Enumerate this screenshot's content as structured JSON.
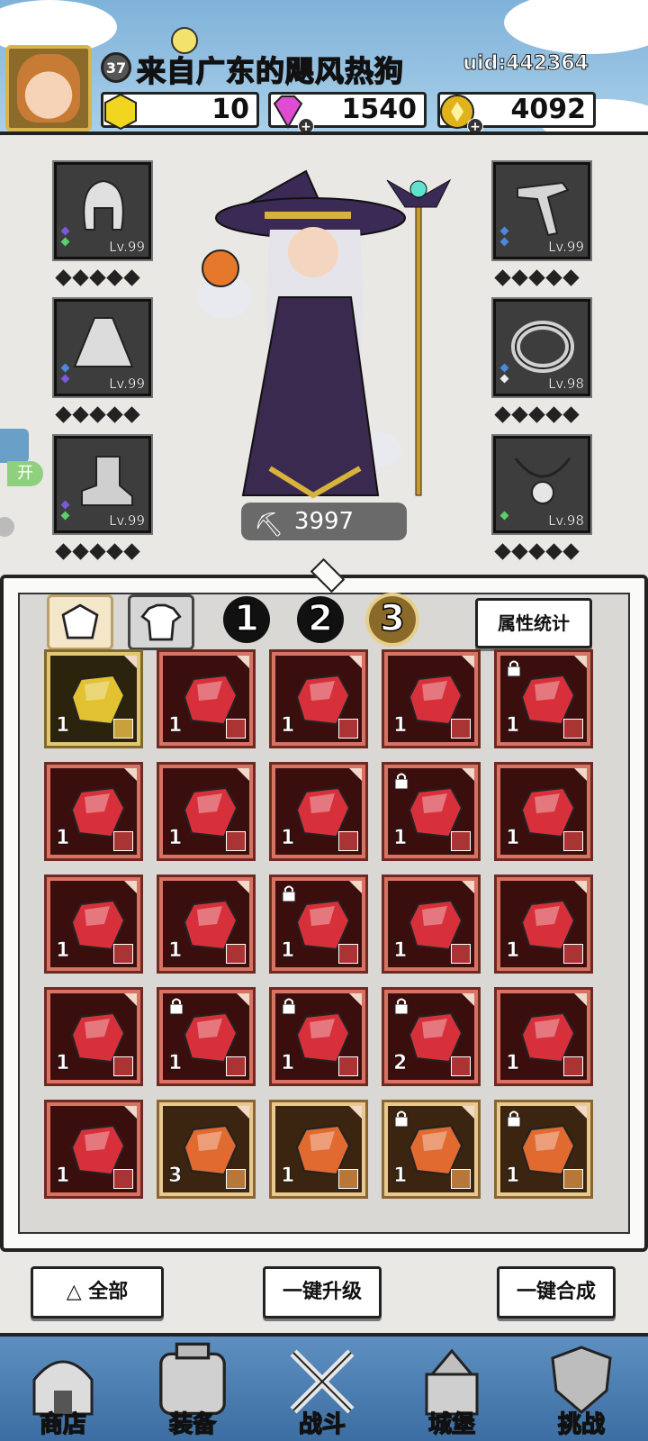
{
  "player": {
    "level": "37",
    "name": "来自广东的飓风热狗",
    "uid": "uid:442364"
  },
  "resources": [
    {
      "name": "gold-gem",
      "value": "10",
      "has_plus": false,
      "color": "#f2d51f"
    },
    {
      "name": "diamond",
      "value": "1540",
      "has_plus": true,
      "color": "#e04bd3"
    },
    {
      "name": "coin",
      "value": "4092",
      "has_plus": true,
      "color": "#e0b31c"
    }
  ],
  "equipment": {
    "left": [
      {
        "slot": "helmet",
        "level": "Lv.99"
      },
      {
        "slot": "cape",
        "level": "Lv.99"
      },
      {
        "slot": "boots",
        "level": "Lv.99"
      }
    ],
    "right": [
      {
        "slot": "weapon",
        "level": "Lv.99"
      },
      {
        "slot": "ring",
        "level": "Lv.98"
      },
      {
        "slot": "necklace",
        "level": "Lv.98"
      }
    ]
  },
  "power": "3997",
  "side_button": "开",
  "tabs": {
    "pages": [
      "1",
      "2",
      "3"
    ],
    "active_page": "3",
    "stats_button": "属性统计"
  },
  "inventory": [
    {
      "type": "gold",
      "count": "1",
      "locked": false,
      "icon": "ring-type-icon"
    },
    {
      "type": "red",
      "count": "1",
      "locked": false,
      "icon": "cape-type-icon"
    },
    {
      "type": "red",
      "count": "1",
      "locked": false,
      "icon": "cape-type-icon"
    },
    {
      "type": "red",
      "count": "1",
      "locked": false,
      "icon": "cape-type-icon"
    },
    {
      "type": "red",
      "count": "1",
      "locked": true,
      "icon": "boots-type-icon"
    },
    {
      "type": "red",
      "count": "1",
      "locked": false,
      "icon": "boots-type-icon"
    },
    {
      "type": "red",
      "count": "1",
      "locked": false,
      "icon": "boots-type-icon"
    },
    {
      "type": "red",
      "count": "1",
      "locked": false,
      "icon": "boots-type-icon"
    },
    {
      "type": "red",
      "count": "1",
      "locked": true,
      "icon": "weapon-type-icon"
    },
    {
      "type": "red",
      "count": "1",
      "locked": false,
      "icon": "weapon-type-icon"
    },
    {
      "type": "red",
      "count": "1",
      "locked": false,
      "icon": "weapon-type-icon"
    },
    {
      "type": "red",
      "count": "1",
      "locked": false,
      "icon": "weapon-type-icon"
    },
    {
      "type": "red",
      "count": "1",
      "locked": true,
      "icon": "ring-type-icon"
    },
    {
      "type": "red",
      "count": "1",
      "locked": false,
      "icon": "ring-type-icon"
    },
    {
      "type": "red",
      "count": "1",
      "locked": false,
      "icon": "ring-type-icon"
    },
    {
      "type": "red",
      "count": "1",
      "locked": false,
      "icon": "ring-type-icon"
    },
    {
      "type": "red",
      "count": "1",
      "locked": true,
      "icon": "necklace-type-icon"
    },
    {
      "type": "red",
      "count": "1",
      "locked": true,
      "icon": "necklace-type-icon"
    },
    {
      "type": "red",
      "count": "2",
      "locked": true,
      "icon": "necklace-type-icon"
    },
    {
      "type": "red",
      "count": "1",
      "locked": false,
      "icon": "necklace-type-icon"
    },
    {
      "type": "red",
      "count": "1",
      "locked": false,
      "icon": "necklace-type-icon"
    },
    {
      "type": "orange",
      "count": "3",
      "locked": false,
      "icon": "cape-type-icon"
    },
    {
      "type": "orange",
      "count": "1",
      "locked": false,
      "icon": "cape-type-icon"
    },
    {
      "type": "orange",
      "count": "1",
      "locked": true,
      "icon": "cape-type-icon"
    },
    {
      "type": "orange",
      "count": "1",
      "locked": true,
      "icon": "cape-type-icon"
    }
  ],
  "actions": {
    "filter": "全部",
    "upgrade": "一键升级",
    "combine": "一键合成"
  },
  "nav": [
    {
      "label": "商店",
      "icon": "shop-icon",
      "active": false
    },
    {
      "label": "装备",
      "icon": "equipment-bag-icon",
      "active": true
    },
    {
      "label": "战斗",
      "icon": "crossed-swords-icon",
      "active": false
    },
    {
      "label": "城堡",
      "icon": "castle-icon",
      "active": false
    },
    {
      "label": "挑战",
      "icon": "shield-icon",
      "active": false
    }
  ],
  "colors": {
    "red_gem": "#d8303a",
    "gold_gem": "#e2c230",
    "orange_gem": "#e06a30",
    "slot_red_border": "#d87263",
    "nav_bg": "#4d7fb3"
  }
}
